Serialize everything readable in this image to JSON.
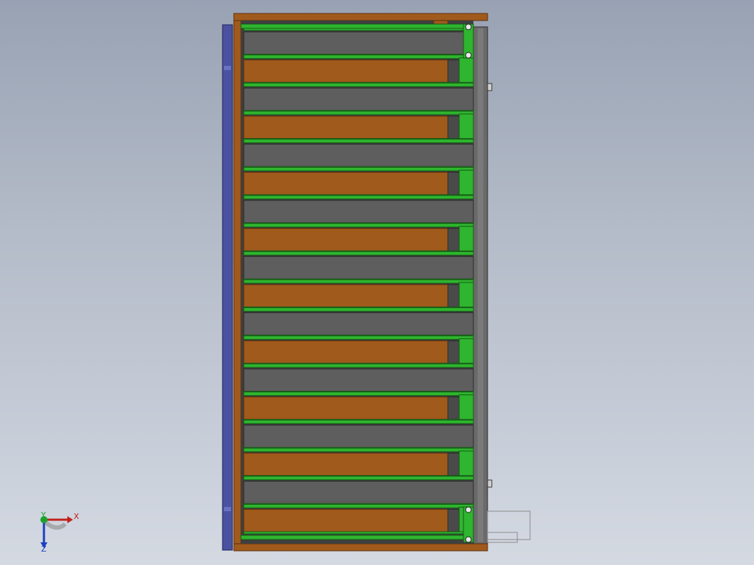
{
  "window": {
    "type": "cad-graphics-area",
    "view": "top"
  },
  "colors": {
    "background_top": "#98a2b3",
    "background_bottom": "#d4d9e2",
    "wood": "#a05a1c",
    "wood_edge": "#5c2f0a",
    "green": "#2fb52f",
    "green_edge": "#145a14",
    "gray": "#5e5e5e",
    "gray_edge": "#2a2a2a",
    "blue": "#4a52a0",
    "x_axis": "#c0201a",
    "y_axis": "#19a32a",
    "z_axis": "#1a3fc0"
  },
  "model": {
    "row_pattern": [
      "gray",
      "wood"
    ],
    "row_count": 18
  },
  "triad": {
    "x_label": "X",
    "y_label": "Y",
    "z_label": "Z"
  }
}
